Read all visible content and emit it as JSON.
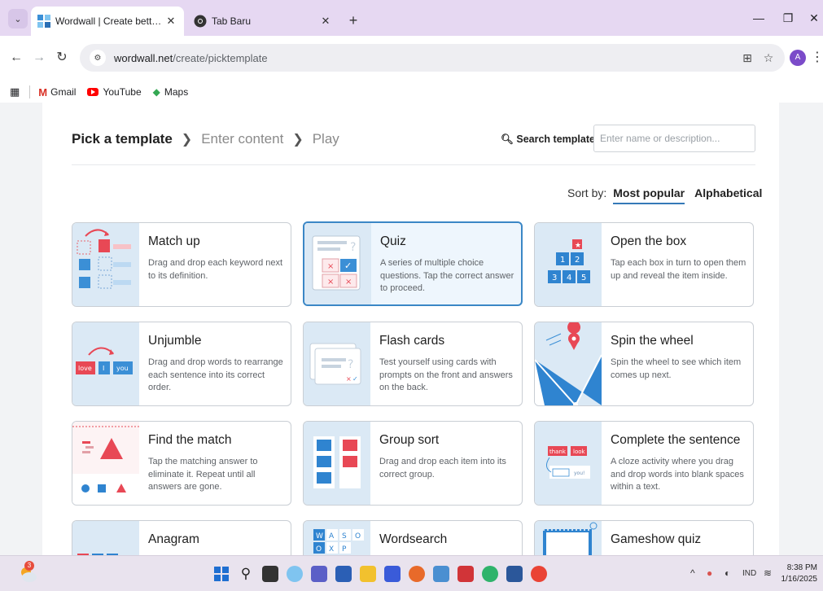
{
  "browser": {
    "tabs": [
      {
        "title": "Wordwall | Create better lessons quicker",
        "active": true
      },
      {
        "title": "Tab Baru",
        "active": false
      }
    ],
    "url_host": "wordwall.net",
    "url_path": "/create/picktemplate",
    "profile_initial": "A",
    "bookmarks": [
      "Gmail",
      "YouTube",
      "Maps"
    ]
  },
  "wizard": {
    "steps": [
      "Pick a template",
      "Enter content",
      "Play"
    ],
    "search_label": "Search templates:",
    "search_placeholder": "Enter name or description...",
    "sort_label": "Sort by:",
    "sort_options": [
      "Most popular",
      "Alphabetical"
    ]
  },
  "templates": [
    {
      "title": "Match up",
      "desc": "Drag and drop each keyword next to its definition."
    },
    {
      "title": "Quiz",
      "desc": "A series of multiple choice questions. Tap the correct answer to proceed."
    },
    {
      "title": "Open the box",
      "desc": "Tap each box in turn to open them up and reveal the item inside."
    },
    {
      "title": "Unjumble",
      "desc": "Drag and drop words to rearrange each sentence into its correct order."
    },
    {
      "title": "Flash cards",
      "desc": "Test yourself using cards with prompts on the front and answers on the back."
    },
    {
      "title": "Spin the wheel",
      "desc": "Spin the wheel to see which item comes up next."
    },
    {
      "title": "Find the match",
      "desc": "Tap the matching answer to eliminate it. Repeat until all answers are gone."
    },
    {
      "title": "Group sort",
      "desc": "Drag and drop each item into its correct group."
    },
    {
      "title": "Complete the sentence",
      "desc": "A cloze activity where you drag and drop words into blank spaces within a text."
    },
    {
      "title": "Anagram",
      "desc": ""
    },
    {
      "title": "Wordsearch",
      "desc": ""
    },
    {
      "title": "Gameshow quiz",
      "desc": ""
    }
  ],
  "thumb_text": {
    "unjumble_words": [
      "love",
      "I",
      "you"
    ],
    "open_box_numbers": [
      "1",
      "2",
      "3",
      "4",
      "5"
    ],
    "complete_words": [
      "thank",
      "look",
      "you!"
    ],
    "wordsearch_letters": [
      "W",
      "A",
      "S",
      "O",
      "O",
      "X",
      "P"
    ],
    "quiz_q": "?"
  },
  "taskbar": {
    "weather_badge": "3",
    "lang": "IND",
    "time": "8:38 PM",
    "date": "1/16/2025"
  }
}
